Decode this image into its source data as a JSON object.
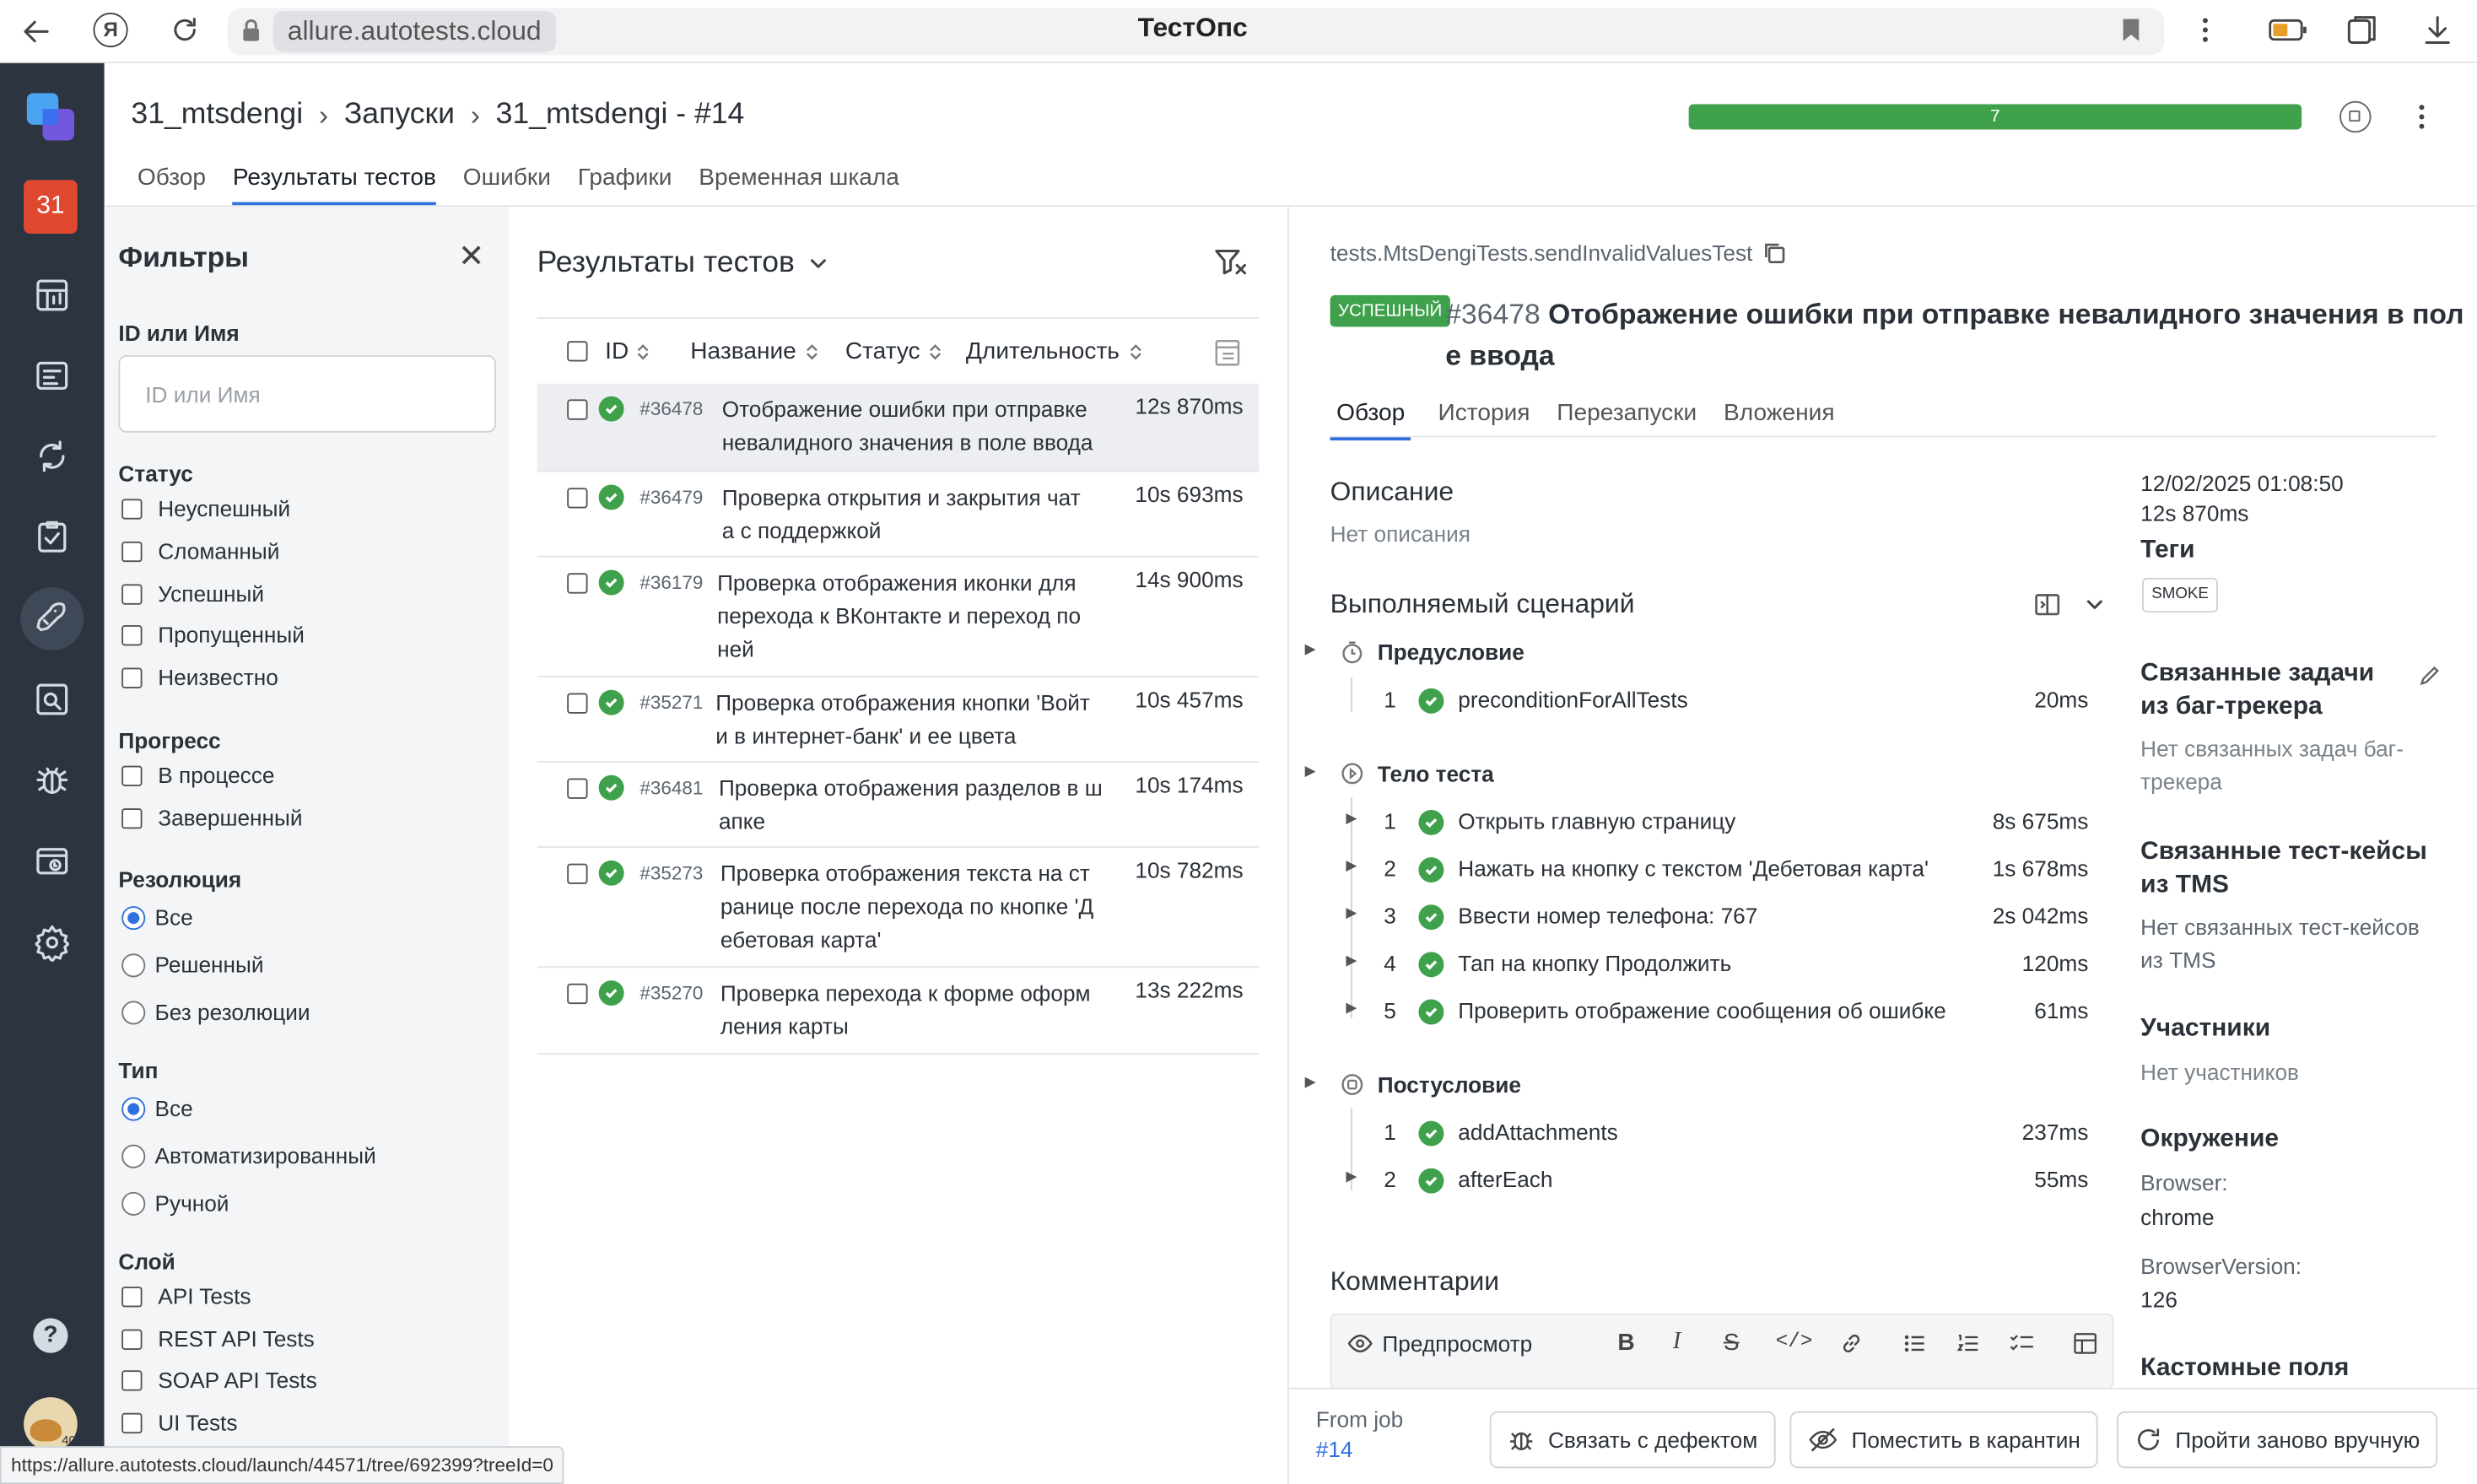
{
  "browser": {
    "url": "allure.autotests.cloud",
    "title": "ТестОпс",
    "status_url": "https://allure.autotests.cloud/launch/44571/tree/692399?treeId=0"
  },
  "sidebar": {
    "project_badge": "31",
    "avatar_badge": "40"
  },
  "header": {
    "breadcrumbs": [
      "31_mtsdengi",
      "Запуски",
      "31_mtsdengi - #14"
    ],
    "progress_count": "7",
    "progress_passed_fraction": 1.0,
    "tabs": [
      "Обзор",
      "Результаты тестов",
      "Ошибки",
      "Графики",
      "Временная шкала"
    ],
    "active_tab": "Результаты тестов"
  },
  "filters": {
    "title": "Фильтры",
    "id_label": "ID или Имя",
    "id_placeholder": "ID или Имя",
    "status_label": "Статус",
    "status_items": [
      "Неуспешный",
      "Сломанный",
      "Успешный",
      "Пропущенный",
      "Неизвестно"
    ],
    "progress_label": "Прогресс",
    "progress_items": [
      "В процессе",
      "Завершенный"
    ],
    "resolution_label": "Резолюция",
    "resolution_items": [
      "Все",
      "Решенный",
      "Без резолюции"
    ],
    "type_label": "Тип",
    "type_items": [
      "Все",
      "Автоматизированный",
      "Ручной"
    ],
    "layer_label": "Слой",
    "layer_items": [
      "API Tests",
      "REST API Tests",
      "SOAP API Tests",
      "UI Tests"
    ]
  },
  "results": {
    "title": "Результаты тестов",
    "columns": [
      "ID",
      "Название",
      "Статус",
      "Длительность"
    ],
    "rows": [
      {
        "id": "#36478",
        "name": [
          "Отображение ошибки при отправке",
          "невалидного значения в поле ввода"
        ],
        "duration": "12s 870ms"
      },
      {
        "id": "#36479",
        "name": [
          "Проверка открытия и закрытия чат",
          "а с поддержкой"
        ],
        "duration": "10s 693ms"
      },
      {
        "id": "#36179",
        "name": [
          "Проверка отображения иконки для",
          "перехода к ВКонтакте и переход по",
          "ней"
        ],
        "duration": "14s 900ms"
      },
      {
        "id": "#35271",
        "name": [
          "Проверка отображения кнопки 'Войт",
          "и в интернет-банк' и ее цвета"
        ],
        "duration": "10s 457ms"
      },
      {
        "id": "#36481",
        "name": [
          "Проверка отображения разделов в ш",
          "апке"
        ],
        "duration": "10s 174ms"
      },
      {
        "id": "#35273",
        "name": [
          "Проверка отображения текста на ст",
          "ранице после перехода по кнопке 'Д",
          "ебетовая карта'"
        ],
        "duration": "10s 782ms"
      },
      {
        "id": "#35270",
        "name": [
          "Проверка перехода к форме оформ",
          "ления карты"
        ],
        "duration": "13s 222ms"
      }
    ]
  },
  "detail": {
    "path": "tests.MtsDengiTests.sendInvalidValuesTest",
    "status_badge": "УСПЕШНЫЙ",
    "test_id": "#36478",
    "title_line1": "Отображение ошибки при отправке невалидного значения в пол",
    "title_line2": "е ввода",
    "tabs": [
      "Обзор",
      "История",
      "Перезапуски",
      "Вложения"
    ],
    "description_label": "Описание",
    "description_value": "Нет описания",
    "scenario_label": "Выполняемый сценарий",
    "precondition_label": "Предусловие",
    "precondition_steps": [
      {
        "n": "1",
        "name": "preconditionForAllTests",
        "duration": "20ms"
      }
    ],
    "body_label": "Тело теста",
    "body_steps": [
      {
        "n": "1",
        "name": "Открыть главную страницу",
        "duration": "8s 675ms"
      },
      {
        "n": "2",
        "name": "Нажать на кнопку с текстом 'Дебетовая карта'",
        "duration": "1s 678ms"
      },
      {
        "n": "3",
        "name": "Ввести номер телефона: 767",
        "duration": "2s 042ms"
      },
      {
        "n": "4",
        "name": "Тап на кнопку Продолжить",
        "duration": "120ms"
      },
      {
        "n": "5",
        "name": "Проверить отображение сообщения об ошибке",
        "duration": "61ms"
      }
    ],
    "postcondition_label": "Постусловие",
    "postcondition_steps": [
      {
        "n": "1",
        "name": "addAttachments",
        "duration": "237ms"
      },
      {
        "n": "2",
        "name": "afterEach",
        "duration": "55ms"
      }
    ],
    "comments_label": "Комментарии",
    "preview_label": "Предпросмотр",
    "side": {
      "datetime": "12/02/2025 01:08:50",
      "duration": "12s 870ms",
      "tags_label": "Теги",
      "tag": "SMOKE",
      "issues_label_1": "Связанные задачи",
      "issues_label_2": "из баг-трекера",
      "issues_value_1": "Нет связанных задач баг-",
      "issues_value_2": "трекера",
      "tms_label_1": "Связанные тест-кейсы",
      "tms_label_2": "из TMS",
      "tms_value_1": "Нет связанных тест-кейсов",
      "tms_value_2": "из TMS",
      "members_label": "Участники",
      "members_value": "Нет участников",
      "env_label": "Окружение",
      "env_browser_key": "Browser:",
      "env_browser_val": "chrome",
      "env_version_key": "BrowserVersion:",
      "env_version_val": "126",
      "custom_fields_label": "Кастомные поля"
    },
    "footer": {
      "from_job": "From job",
      "job_link": "#14",
      "link_defect": "Связать с дефектом",
      "quarantine": "Поместить в карантин",
      "rerun_manual": "Пройти заново вручную"
    }
  }
}
